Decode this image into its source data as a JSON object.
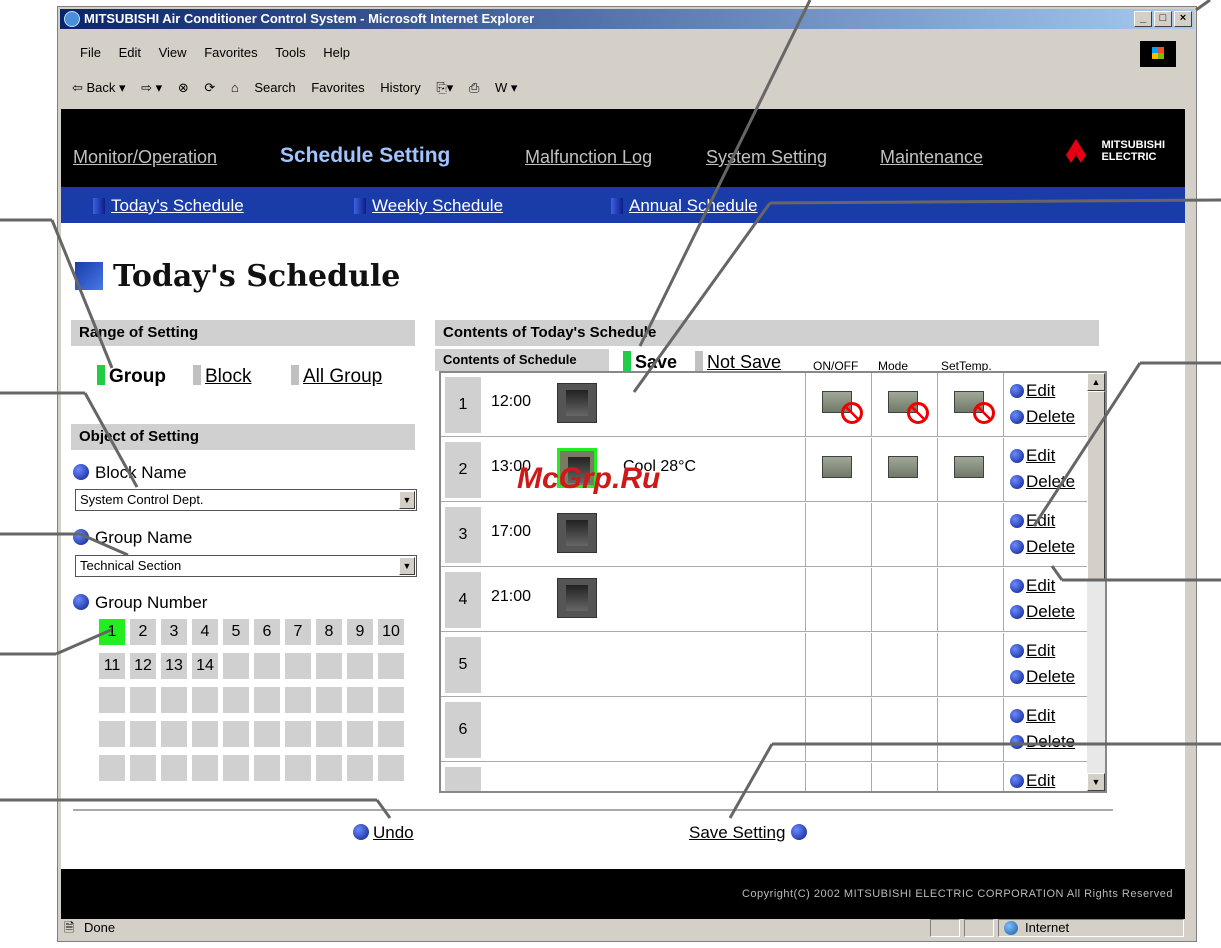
{
  "window": {
    "title": "MITSUBISHI Air Conditioner Control System - Microsoft Internet Explorer",
    "min": "_",
    "max": "□",
    "close": "×"
  },
  "menu": [
    "File",
    "Edit",
    "View",
    "Favorites",
    "Tools",
    "Help"
  ],
  "toolbar": [
    "⇦ Back ▾",
    "⇨ ▾",
    "⊗",
    "⟳",
    "⌂",
    "Search",
    "Favorites",
    "History",
    "⎘▾",
    "⎙",
    "W ▾"
  ],
  "nav": {
    "items": [
      "Monitor/Operation",
      "Schedule Setting",
      "Malfunction Log",
      "System Setting",
      "Maintenance"
    ],
    "logo": [
      "MITSUBISHI",
      "ELECTRIC"
    ]
  },
  "subnav": [
    "Today's Schedule",
    "Weekly Schedule",
    "Annual Schedule"
  ],
  "heading": "Today's Schedule",
  "range": {
    "title": "Range of Setting",
    "options": [
      "Group",
      "Block",
      "All Group"
    ]
  },
  "object": {
    "title": "Object of Setting",
    "block_label": "Block Name",
    "block_value": "System Control Dept.",
    "group_label": "Group Name",
    "group_value": "Technical Section",
    "number_label": "Group Number",
    "numbers": [
      "1",
      "2",
      "3",
      "4",
      "5",
      "6",
      "7",
      "8",
      "9",
      "10",
      "11",
      "12",
      "13",
      "14"
    ]
  },
  "contents": {
    "title": "Contents of Today's Schedule",
    "sub_title": "Contents of Schedule",
    "save": "Save",
    "not_save": "Not Save",
    "col_onoff": "ON/OFF",
    "col_mode": "Mode",
    "col_temp": "SetTemp.",
    "edit": "Edit",
    "delete": "Delete",
    "rows": [
      {
        "n": "1",
        "time": "12:00",
        "extra": ""
      },
      {
        "n": "2",
        "time": "13:00",
        "extra": "Cool  28°C"
      },
      {
        "n": "3",
        "time": "17:00",
        "extra": ""
      },
      {
        "n": "4",
        "time": "21:00",
        "extra": ""
      },
      {
        "n": "5",
        "time": "",
        "extra": ""
      },
      {
        "n": "6",
        "time": "",
        "extra": ""
      },
      {
        "n": "",
        "time": "",
        "extra": ""
      }
    ]
  },
  "footer": {
    "undo": "Undo",
    "save_setting": "Save Setting",
    "copyright": "Copyright(C) 2002 MITSUBISHI ELECTRIC CORPORATION All Rights Reserved"
  },
  "status": {
    "done": "Done",
    "zone": "Internet"
  },
  "watermark": "McGrp.Ru"
}
